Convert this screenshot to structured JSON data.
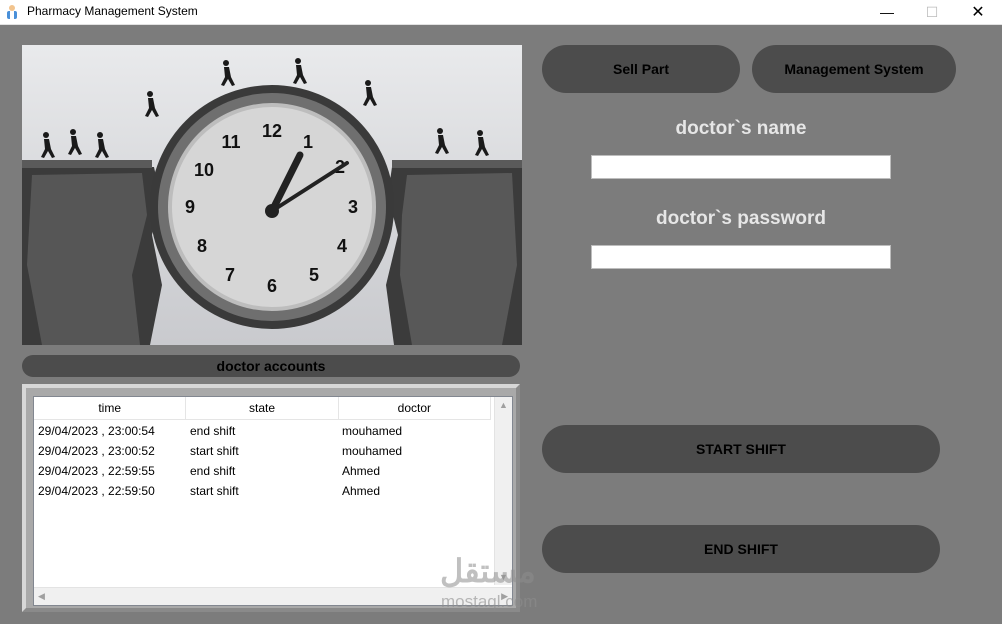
{
  "window": {
    "title": "Pharmacy Management System",
    "minimize": "—",
    "maximize": "☐",
    "close": "✕"
  },
  "hero": {
    "icon": "clock-bridge-illustration",
    "clock_numbers": [
      "12",
      "1",
      "2",
      "3",
      "4",
      "5",
      "6",
      "7",
      "8",
      "9",
      "10",
      "11"
    ]
  },
  "accounts": {
    "title": "doctor accounts",
    "columns": [
      "time",
      "state",
      "doctor"
    ],
    "rows": [
      [
        "29/04/2023 , 23:00:54",
        "end shift",
        "mouhamed"
      ],
      [
        "29/04/2023 , 23:00:52",
        "start shift",
        "mouhamed"
      ],
      [
        "29/04/2023 , 22:59:55",
        "end shift",
        "Ahmed"
      ],
      [
        "29/04/2023 , 22:59:50",
        "start shift",
        "Ahmed"
      ]
    ]
  },
  "nav": {
    "sell_label": "Sell Part",
    "management_label": "Management System"
  },
  "form": {
    "name_label": "doctor`s name",
    "name_value": "",
    "password_label": "doctor`s password",
    "password_value": ""
  },
  "actions": {
    "start_label": "START SHIFT",
    "end_label": "END SHIFT"
  },
  "watermark": {
    "text": "مستقل",
    "sub": "mostaql.com"
  },
  "colors": {
    "background": "#7c7c7c",
    "button": "#4c4c4c",
    "label": "#e6e6e6"
  }
}
